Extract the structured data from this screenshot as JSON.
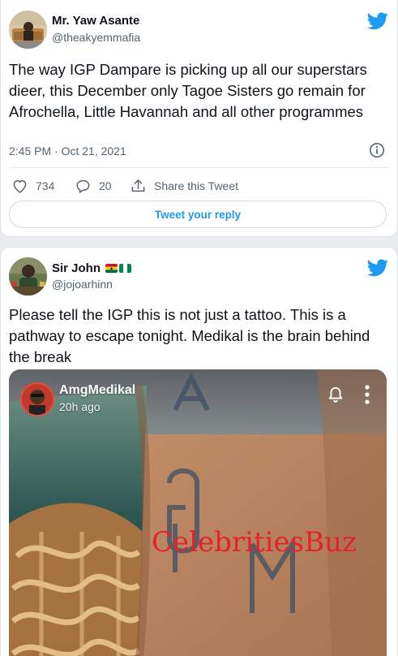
{
  "tweets": [
    {
      "author_name": "Mr. Yaw Asante",
      "author_handle": "@theakyemmafia",
      "text": "The way IGP Dampare is picking up all our superstars dieer, this December only Tagoe Sisters go remain for Afrochella, Little Havannah and all other programmes",
      "time": "2:45 PM",
      "date": "Oct 21, 2021",
      "meta": "2:45 PM · Oct 21, 2021",
      "likes": "734",
      "replies": "20",
      "share_label": "Share this Tweet",
      "reply_button_label": "Tweet your reply",
      "icons": [
        "twitter-bird-icon",
        "info-icon",
        "heart-icon",
        "reply-icon",
        "share-icon"
      ]
    },
    {
      "author_name": "Sir John",
      "author_handle": "@jojoarhinn",
      "flags": [
        "ghana-flag-icon",
        "nigeria-flag-icon"
      ],
      "text": "Please tell the IGP this is not just a tattoo. This is a pathway to escape tonight. Medikal is the brain behind the break",
      "media": {
        "story_name": "AmgMedikal",
        "story_time": "20h ago",
        "watermark": "CelebritiesBuz",
        "tattoo_letters": "AMG",
        "icons": [
          "bell-icon",
          "more-vertical-icon"
        ]
      }
    }
  ],
  "colors": {
    "twitter_blue": "#1d9bf0",
    "secondary_text": "#536471",
    "watermark_red": "#e8202a"
  }
}
